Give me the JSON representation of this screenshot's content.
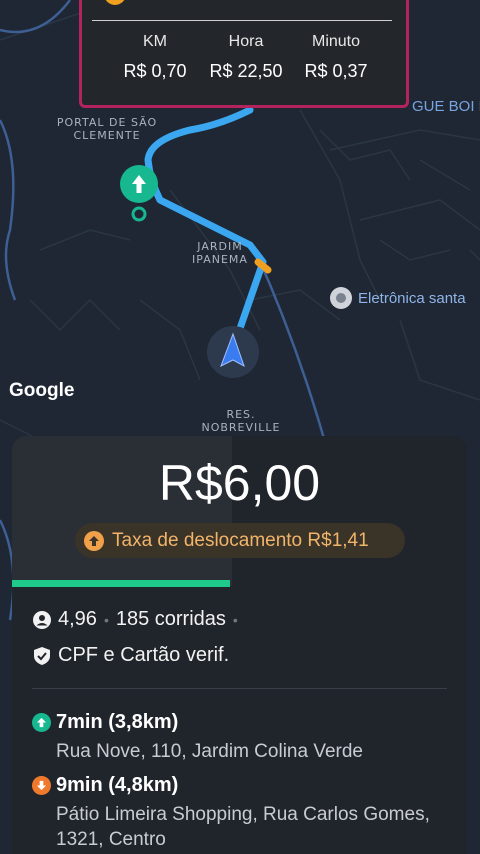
{
  "map": {
    "labels": {
      "portal": "PORTAL DE SÃO\nCLEMENTE",
      "jardim": "JARDIM\nIPANEMA",
      "res": "RES.\nNOBREVILLE",
      "ague": "GUE BOI M"
    },
    "poi": "Eletrônica santa",
    "google": "Google",
    "colors": {
      "route": "#3aa7f0",
      "pickup": "#17b890",
      "background": "#1e2733"
    }
  },
  "rate_card": {
    "columns": [
      {
        "header": "KM",
        "value": "R$ 0,70"
      },
      {
        "header": "Hora",
        "value": "R$ 22,50"
      },
      {
        "header": "Minuto",
        "value": "R$ 0,37"
      }
    ],
    "border_color": "#b3245f"
  },
  "offer": {
    "price": "R$6,00",
    "fee_label": "Taxa de deslocamento R$1,41",
    "rating": "4,96",
    "rides": "185 corridas",
    "verification": "CPF e Cartão verif.",
    "progress_fraction": 0.48
  },
  "stops": {
    "pickup": {
      "title": "7min (3,8km)",
      "address": "Rua Nove, 110, Jardim Colina Verde",
      "color": "#17b890"
    },
    "dropoff": {
      "title": "9min (4,8km)",
      "address": "Pátio Limeira Shopping, Rua Carlos Gomes, 1321, Centro",
      "color": "#f07a2c"
    }
  }
}
